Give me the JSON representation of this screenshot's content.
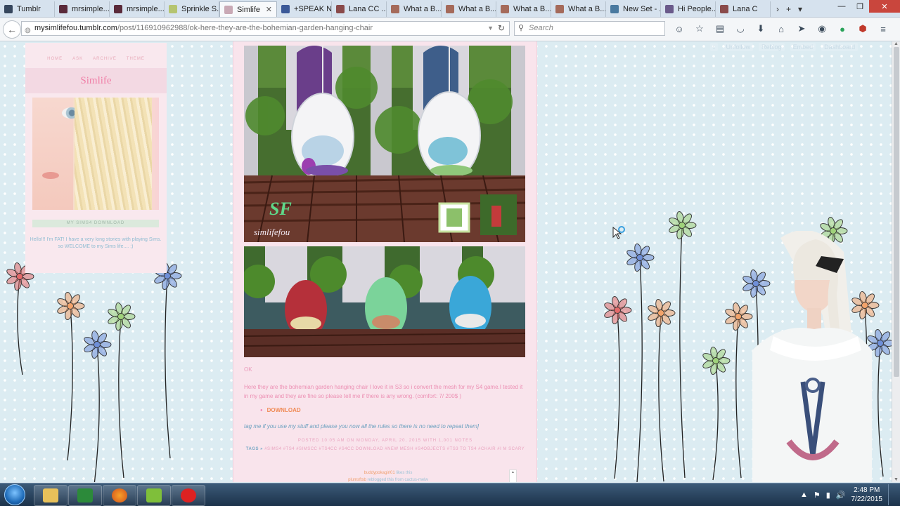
{
  "browser": {
    "tabs": [
      {
        "title": "Tumblr",
        "icon": "tumblr-icon",
        "color": "#36465d"
      },
      {
        "title": "mrsimple...",
        "icon": "site-icon",
        "color": "#5a2a3a"
      },
      {
        "title": "mrsimple...",
        "icon": "site-icon",
        "color": "#5a2a3a"
      },
      {
        "title": "Sprinkle S...",
        "icon": "leaf-icon",
        "color": "#b5c470"
      },
      {
        "title": "Simlife",
        "icon": "simlife-icon",
        "color": "#c9a9b5",
        "active": true
      },
      {
        "title": "+SPEAK N...",
        "icon": "facebook-icon",
        "color": "#3b5998"
      },
      {
        "title": "Lana CC ...",
        "icon": "site-icon",
        "color": "#8a4a4a"
      },
      {
        "title": "What a B...",
        "icon": "site-icon",
        "color": "#a56a5a"
      },
      {
        "title": "What a B...",
        "icon": "site-icon",
        "color": "#a56a5a"
      },
      {
        "title": "What a B...",
        "icon": "site-icon",
        "color": "#a56a5a"
      },
      {
        "title": "What a B...",
        "icon": "site-icon",
        "color": "#a56a5a"
      },
      {
        "title": "New Set - ...",
        "icon": "site-icon",
        "color": "#4a7aa0"
      },
      {
        "title": "Hi People...",
        "icon": "site-icon",
        "color": "#6a5a8a"
      },
      {
        "title": "Lana C",
        "icon": "site-icon",
        "color": "#8a4a4a"
      }
    ],
    "url": {
      "domain": "mysimlifefou.tumblr.com",
      "path": "/post/116910962988/ok-here-they-are-the-bohemian-garden-hanging-chair",
      "prefix": ""
    },
    "search_placeholder": "Search"
  },
  "blog": {
    "nav": [
      "HOME",
      "ASK",
      "ARCHIVE",
      "THEME"
    ],
    "title": "Simlife",
    "sims_download": "MY SIMS4 DOWNLOAD",
    "description": "Hello!!! I'm FAT! I have a very long stories with playing Sims. so WELCOME to my Sims life.... :)"
  },
  "tumblr_controls": {
    "unfollow": "Unfollow",
    "reblog": "Reblog",
    "embed": "Embed",
    "dashboard": "Dashboard"
  },
  "post": {
    "watermark_sf": "SF",
    "watermark_name": "simlifefou",
    "ok": "OK",
    "body": "Here they are the bohemian garden hanging chair I love it in S3 so i convert the mesh for my S4 game.I tested it in my game and they are fine so please tell me if there is any wrong. (comfort: 7/ 200$ )",
    "download": "DOWNLOAD",
    "tagme": "tag me if you use my stuff and please you now all the rules so there is no need to repeat them]",
    "meta": "POSTED 10:05 AM ON MONDAY, APRIL 20, 2015 WITH 1,001 NOTES",
    "tags_label": "TAGS »",
    "tags": "#SIMS4 #TS4 #SIMSCC #TS4CC #S4CC DOWNLOAD #NEW MESH #S4OBJECTS #TS3 TO TS4 #CHAIR #I M SCARY",
    "notes": [
      {
        "user": "buddypokagirl01",
        "action": "likes this"
      },
      {
        "user": "plumsftsb",
        "action": "reblogged this from cactus-melw"
      }
    ]
  },
  "taskbar": {
    "time": "2:48 PM",
    "date": "7/22/2015"
  },
  "colors": {
    "accent_pink": "#f07fa7",
    "bg_blue": "#dcecf2"
  }
}
